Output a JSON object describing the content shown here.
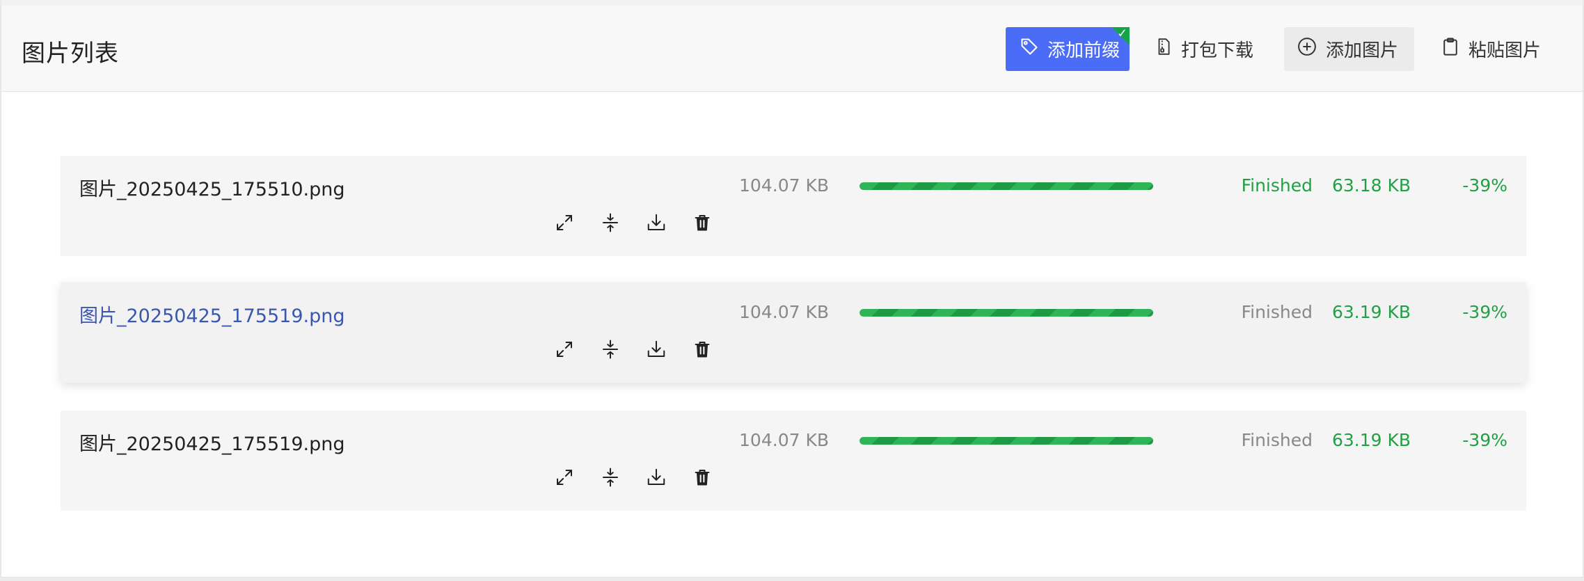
{
  "header": {
    "title": "图片列表",
    "toolbar": {
      "add_prefix": "添加前缀",
      "pack_download": "打包下载",
      "add_image": "添加图片",
      "paste_image": "粘贴图片"
    }
  },
  "colors": {
    "primary": "#4a6cf7",
    "success": "#22a045",
    "badge": "#16a34a",
    "hover_link": "#3a57b0",
    "muted": "#888888"
  },
  "icons": {
    "add_prefix": "tag-icon",
    "pack_download": "zip-file-icon",
    "add_image": "plus-circle-icon",
    "paste_image": "clipboard-icon",
    "row_actions": [
      "expand-icon",
      "compress-icon",
      "download-icon",
      "trash-icon"
    ]
  },
  "files": [
    {
      "name": "图片_20250425_175510.png",
      "original_size": "104.07 KB",
      "progress": 1.0,
      "status": "Finished",
      "status_color": "#22a045",
      "compressed_size": "63.18 KB",
      "ratio": "-39%"
    },
    {
      "name": "图片_20250425_175519.png",
      "original_size": "104.07 KB",
      "progress": 1.0,
      "status": "Finished",
      "status_color": "#888888",
      "compressed_size": "63.19 KB",
      "ratio": "-39%"
    },
    {
      "name": "图片_20250425_175519.png",
      "original_size": "104.07 KB",
      "progress": 1.0,
      "status": "Finished",
      "status_color": "#888888",
      "compressed_size": "63.19 KB",
      "ratio": "-39%"
    }
  ]
}
